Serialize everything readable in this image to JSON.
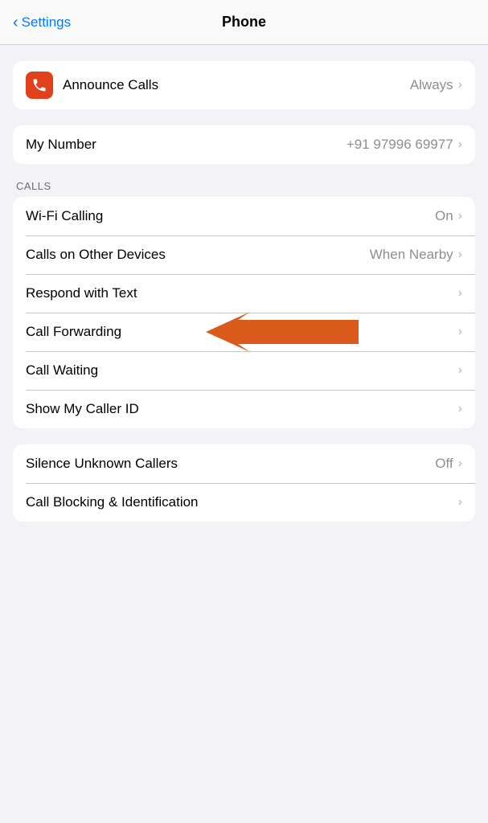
{
  "header": {
    "back_label": "Settings",
    "title": "Phone"
  },
  "announce_calls": {
    "label": "Announce Calls",
    "value": "Always",
    "icon": "phone-icon"
  },
  "my_number": {
    "label": "My Number",
    "value": "+91 97996 69977"
  },
  "calls_section": {
    "label": "CALLS",
    "items": [
      {
        "label": "Wi-Fi Calling",
        "value": "On",
        "has_arrow": true
      },
      {
        "label": "Calls on Other Devices",
        "value": "When Nearby",
        "has_arrow": true
      },
      {
        "label": "Respond with Text",
        "value": "",
        "has_arrow": true
      },
      {
        "label": "Call Forwarding",
        "value": "",
        "has_arrow": true,
        "annotated": true
      },
      {
        "label": "Call Waiting",
        "value": "",
        "has_arrow": true
      },
      {
        "label": "Show My Caller ID",
        "value": "",
        "has_arrow": true
      }
    ]
  },
  "bottom_section": {
    "items": [
      {
        "label": "Silence Unknown Callers",
        "value": "Off",
        "has_arrow": true
      },
      {
        "label": "Call Blocking & Identification",
        "value": "",
        "has_arrow": true
      }
    ]
  }
}
